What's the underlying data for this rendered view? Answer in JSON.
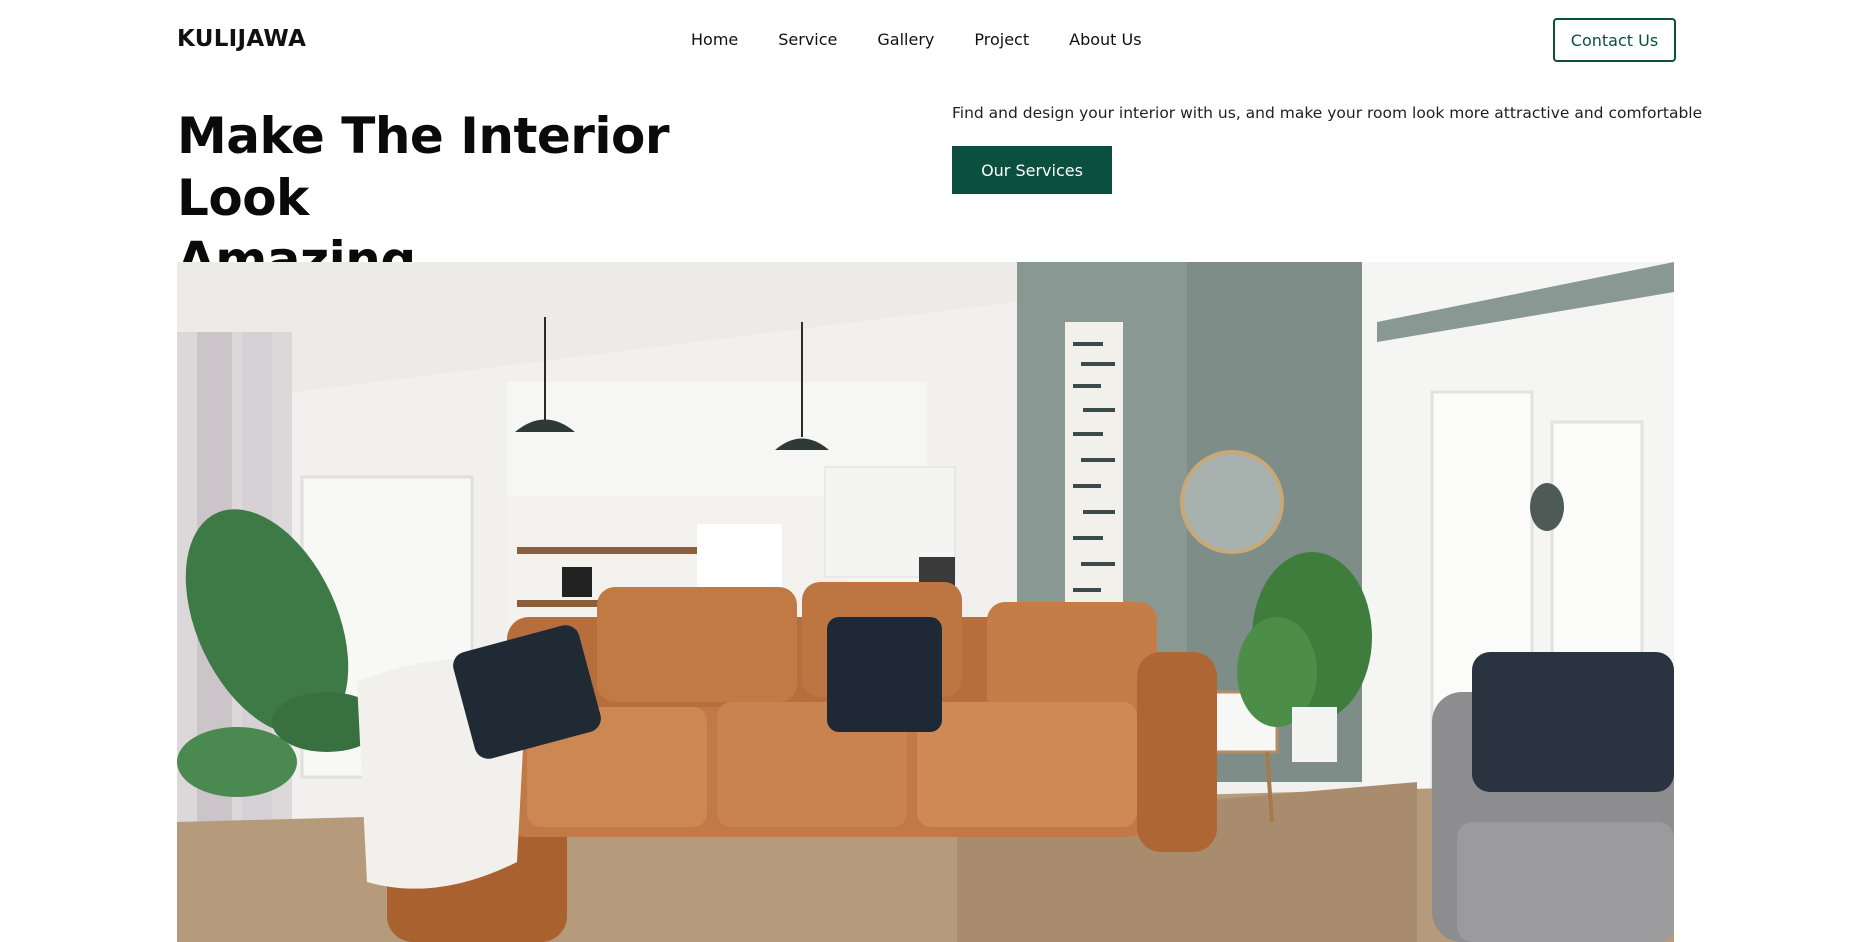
{
  "brand": {
    "logo": "KULIJAWA"
  },
  "nav": {
    "items": [
      {
        "label": "Home"
      },
      {
        "label": "Service"
      },
      {
        "label": "Gallery"
      },
      {
        "label": "Project"
      },
      {
        "label": "About Us"
      }
    ],
    "contact_label": "Contact Us"
  },
  "hero": {
    "title_line1": "Make The Interior Look",
    "title_line2": "Amazing",
    "description": "Find and design your interior with us, and make your room look more attractive and comfortable",
    "cta_label": "Our Services"
  },
  "colors": {
    "accent": "#0b4f3e",
    "text": "#111111",
    "background": "#ffffff"
  }
}
